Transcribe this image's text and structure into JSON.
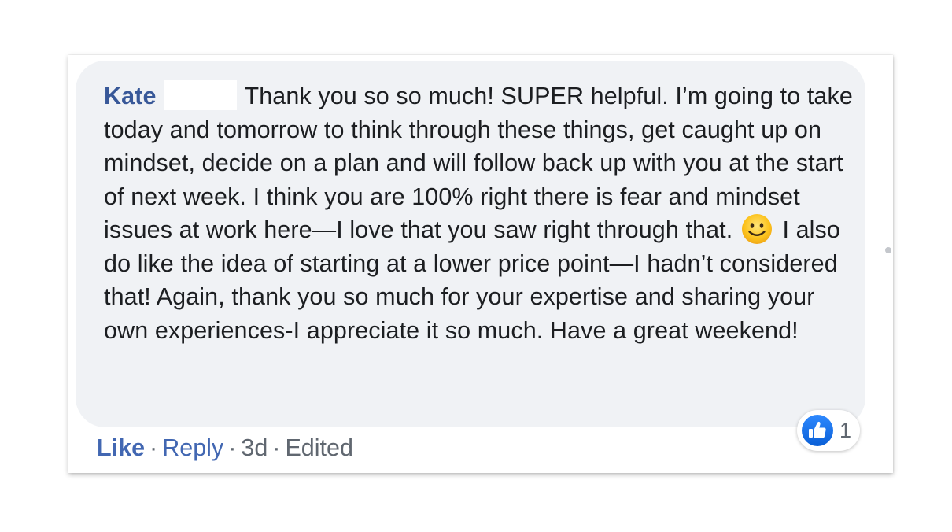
{
  "comment": {
    "author": "Kate",
    "text_part1": "Thank you so so much! SUPER helpful. I’m going to take today and tomorrow to think through these things, get caught up on mindset, decide on a plan and will follow back up with you at the start of next week. I think you are 100% right there is fear and mindset issues at work here—I love that you saw right through that.",
    "emoji": "slightly-smiling-face-icon",
    "text_part2": "I also do like the idea of starting at a lower price point—I hadn’t considered that! Again, thank you so much for your expertise and sharing your own experiences-I appreciate it so much. Have a great weekend!"
  },
  "actions": {
    "like_label": "Like",
    "separator": "·",
    "reply_label": "Reply",
    "time": "3d",
    "edited_label": "Edited"
  },
  "reactions": {
    "icon": "thumbs-up-icon",
    "count": "1"
  },
  "colors": {
    "author": "#385898",
    "link": "#4267b2",
    "bubble": "#f0f2f5",
    "text": "#1c1e21",
    "meta": "#606770"
  }
}
